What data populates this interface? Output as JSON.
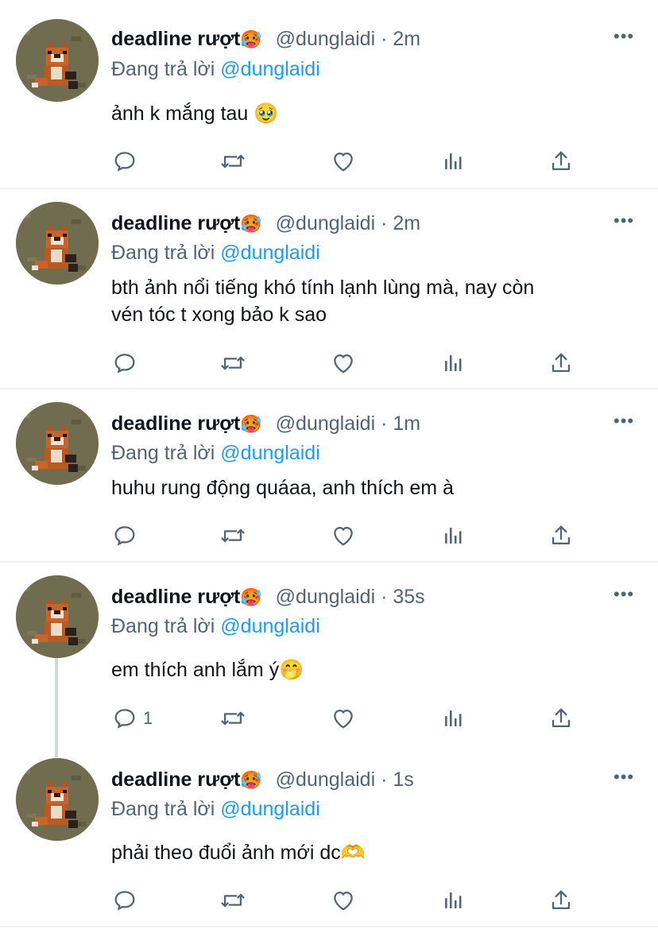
{
  "tweets": [
    {
      "name": "deadline rượt",
      "name_emoji": "🥵",
      "handle": "@dunglaidi",
      "sep": "·",
      "time": "2m",
      "replying_prefix": "Đang trả lời",
      "replying_to": "@dunglaidi",
      "text_lines": [
        "ảnh k mắng tau 🥹"
      ],
      "reply_count": ""
    },
    {
      "name": "deadline rượt",
      "name_emoji": "🥵",
      "handle": "@dunglaidi",
      "sep": "·",
      "time": "2m",
      "replying_prefix": "Đang trả lời",
      "replying_to": "@dunglaidi",
      "text_lines": [
        "bth ảnh nổi tiếng khó tính lạnh lùng mà, nay còn",
        "vén tóc t xong bảo k sao"
      ],
      "reply_count": ""
    },
    {
      "name": "deadline rượt",
      "name_emoji": "🥵",
      "handle": "@dunglaidi",
      "sep": "·",
      "time": "1m",
      "replying_prefix": "Đang trả lời",
      "replying_to": "@dunglaidi",
      "text_lines": [
        "huhu rung động quáaa, anh thích em à"
      ],
      "reply_count": ""
    },
    {
      "name": "deadline rượt",
      "name_emoji": "🥵",
      "handle": "@dunglaidi",
      "sep": "·",
      "time": "35s",
      "replying_prefix": "Đang trả lời",
      "replying_to": "@dunglaidi",
      "text_lines": [
        "em thích anh lắm ý🤭"
      ],
      "reply_count": "1"
    },
    {
      "name": "deadline rượt",
      "name_emoji": "🥵",
      "handle": "@dunglaidi",
      "sep": "·",
      "time": "1s",
      "replying_prefix": "Đang trả lời",
      "replying_to": "@dunglaidi",
      "text_lines": [
        "phải theo đuổi ảnh mới dc🫶"
      ],
      "reply_count": ""
    }
  ],
  "icons": {
    "reply": "reply-icon",
    "retweet": "retweet-icon",
    "like": "heart-icon",
    "views": "views-icon",
    "share": "share-icon",
    "more": "more-icon",
    "avatar": "avatar"
  },
  "colors": {
    "text": "#0f1419",
    "secondary": "#536471",
    "mention": "#1d9bf0",
    "divider": "#eff3f4"
  }
}
